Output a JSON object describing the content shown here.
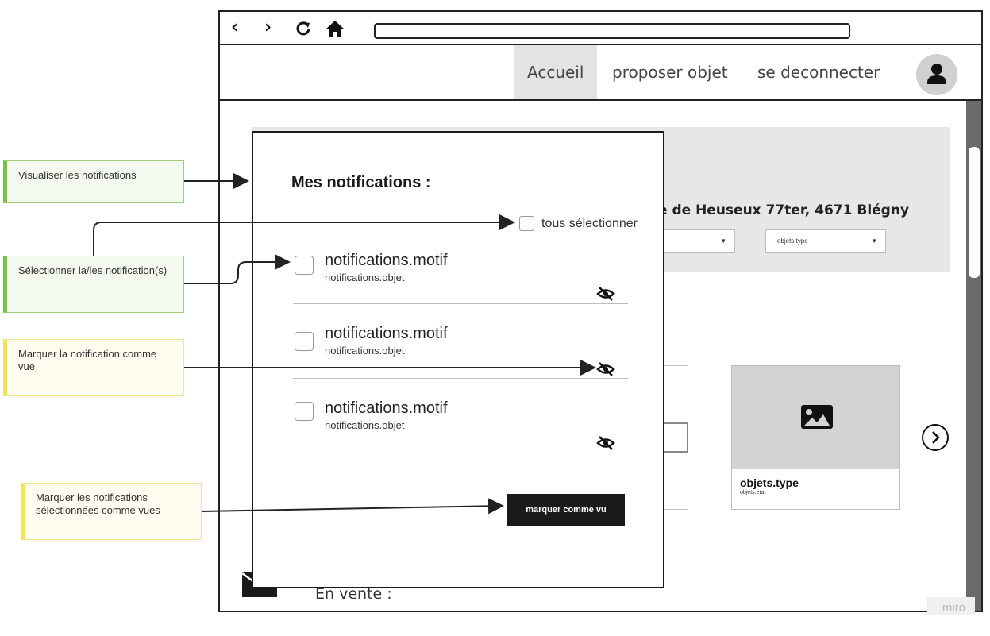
{
  "browser": {
    "toolbar": {
      "back_icon": "‹",
      "forward_icon": "›",
      "reload_icon": "reload-icon",
      "home_icon": "home-icon",
      "address_value": ""
    },
    "navbar": {
      "items": [
        {
          "label": "Accueil",
          "active": true
        },
        {
          "label": "proposer objet",
          "active": false
        },
        {
          "label": "se deconnecter",
          "active": false
        }
      ],
      "avatar_icon": "user-icon"
    },
    "page": {
      "address": "e de Heuseux 77ter, 4671 Blégny",
      "filter_selects": [
        {
          "label": ""
        },
        {
          "label": "objets.type"
        }
      ],
      "card": {
        "title": "objets.type",
        "subtitle": "objets.etat",
        "image_icon": "image-icon"
      },
      "next_icon": "chevron-right-circle-icon",
      "section_title": "En vente :",
      "mail_icon": "mail-icon"
    }
  },
  "modal": {
    "title": "Mes notifications :",
    "select_all_label": "tous sélectionner",
    "notifications": [
      {
        "motif": "notifications.motif",
        "objet": "notifications.objet",
        "seen_icon": "eye-slash-icon"
      },
      {
        "motif": "notifications.motif",
        "objet": "notifications.objet",
        "seen_icon": "eye-slash-icon"
      },
      {
        "motif": "notifications.motif",
        "objet": "notifications.objet",
        "seen_icon": "eye-slash-icon"
      }
    ],
    "mark_button_label": "marquer comme vu"
  },
  "annotations": [
    {
      "text": "Visualiser les notifications",
      "color": "#7bc043"
    },
    {
      "text": "Sélectionner la/les notification(s)",
      "color": "#7bc043"
    },
    {
      "text": "Marquer la notification comme vue",
      "color": "#f2e552"
    },
    {
      "text": "Marquer les notifications sélectionnées comme vues",
      "color": "#f2e552"
    }
  ],
  "watermark": "miro"
}
